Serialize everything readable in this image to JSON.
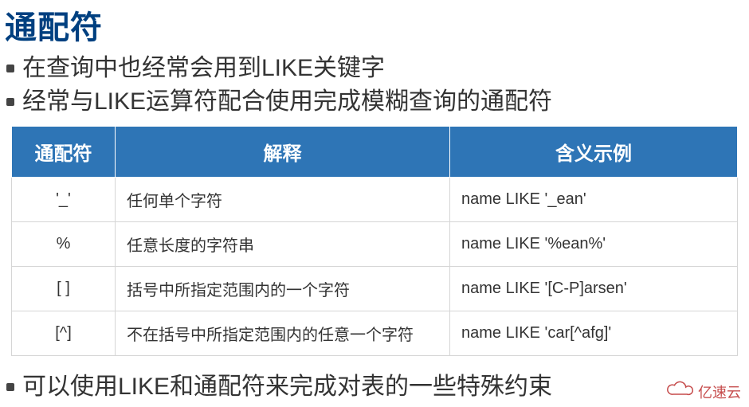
{
  "title": "通配符",
  "intro": [
    "在查询中也经常会用到LIKE关键字",
    "经常与LIKE运算符配合使用完成模糊查询的通配符"
  ],
  "table": {
    "head": {
      "c0": "通配符",
      "c1": "解释",
      "c2": "含义示例"
    },
    "rows": [
      {
        "sym": "'_'",
        "exp": "任何单个字符",
        "ex": "name LIKE '_ean'"
      },
      {
        "sym": "%",
        "exp": "任意长度的字符串",
        "ex": "name LIKE '%ean%'"
      },
      {
        "sym": "[ ]",
        "exp": "括号中所指定范围内的一个字符",
        "ex": "name LIKE '[C-P]arsen'"
      },
      {
        "sym": "[^]",
        "exp": "不在括号中所指定范围内的任意一个字符",
        "ex": "name LIKE 'car[^afg]'"
      }
    ]
  },
  "footer": "可以使用LIKE和通配符来完成对表的一些特殊约束",
  "watermark": "亿速云"
}
